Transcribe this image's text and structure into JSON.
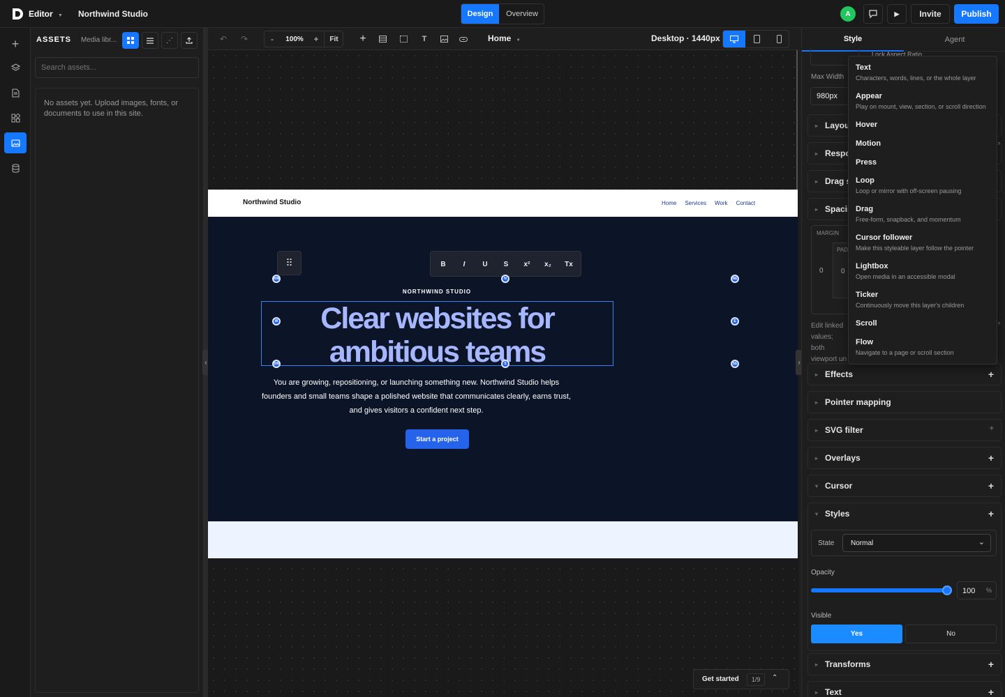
{
  "topbar": {
    "app_label": "Editor",
    "project_name": "Northwind Studio",
    "mode_tabs": [
      "Design",
      "Overview"
    ],
    "avatar_initial": "A",
    "invite_label": "Invite",
    "publish_label": "Publish"
  },
  "assets": {
    "header": "ASSETS",
    "media_tab": "Media libr...",
    "search_placeholder": "Search assets...",
    "empty_text": "No assets yet. Upload images, fonts, or documents to use in this site."
  },
  "canvas_toolbar": {
    "zoom_minus": "-",
    "zoom": "100%",
    "zoom_plus": "+",
    "fit_label": "Fit",
    "page": "Home",
    "breakpoint": "Desktop · 1440px"
  },
  "site": {
    "brand": "Northwind Studio",
    "nav": [
      "Home",
      "Services",
      "Work",
      "Contact"
    ],
    "eyebrow": "NORTHWIND STUDIO",
    "headline_line1": "Clear websites for",
    "headline_line2": "ambitious teams",
    "body": "You are growing, repositioning, or launching something new. Northwind Studio helps founders and small teams shape a polished website that communicates clearly, earns trust, and gives visitors a confident next step.",
    "cta": "Start a project"
  },
  "format_toolbar": [
    "B",
    "I",
    "U",
    "S",
    "x²",
    "x₂",
    "Tx"
  ],
  "handles": {
    "nw": "NW",
    "n": "N",
    "ne": "NE",
    "w": "W",
    "e": "E",
    "sw": "SW",
    "s": "S",
    "se": "SE"
  },
  "get_started": {
    "label": "Get started",
    "progress": "1/9"
  },
  "right_panel": {
    "tabs": [
      "Style",
      "Agent"
    ],
    "lock_aspect": "Lock Aspect Ratio",
    "max_width_label": "Max Width",
    "max_width_value": "980px",
    "collapsed_left": [
      "Layout",
      "Respo",
      "Drag s",
      "Spacin"
    ],
    "margin_label": "MARGIN",
    "padding_label": "PAD",
    "margin_value": "0",
    "padding_value": "0",
    "note": "Edit linked values; both viewport un",
    "sections": [
      "Effects",
      "Pointer mapping",
      "SVG filter",
      "Overlays",
      "Cursor",
      "Styles"
    ],
    "state_label": "State",
    "state_value": "Normal",
    "opacity_label": "Opacity",
    "opacity_value": "100",
    "opacity_unit": "%",
    "opacity_level": 1.0,
    "visible_label": "Visible",
    "visible_yes": "Yes",
    "visible_no": "No",
    "bottom_sections": [
      "Transforms",
      "Text"
    ]
  },
  "interaction_menu": [
    {
      "title": "Text",
      "desc": "Characters, words, lines, or the whole layer"
    },
    {
      "title": "Appear",
      "desc": "Play on mount, view, section, or scroll direction"
    },
    {
      "title": "Hover",
      "desc": ""
    },
    {
      "title": "Motion",
      "desc": "",
      "submenu": true
    },
    {
      "title": "Press",
      "desc": ""
    },
    {
      "title": "Loop",
      "desc": "Loop or mirror with off-screen pausing"
    },
    {
      "title": "Drag",
      "desc": "Free-form, snapback, and momentum"
    },
    {
      "title": "Cursor follower",
      "desc": "Make this styleable layer follow the pointer"
    },
    {
      "title": "Lightbox",
      "desc": "Open media in an accessible modal"
    },
    {
      "title": "Ticker",
      "desc": "Continuously move this layer's children"
    },
    {
      "title": "Scroll",
      "desc": "",
      "submenu": true
    },
    {
      "title": "Flow",
      "desc": "Navigate to a page or scroll section"
    }
  ],
  "colors": {
    "accent": "#1677ff",
    "hero_bg": "#0c1427",
    "headline": "#a6b6ff",
    "cta": "#2563eb"
  }
}
